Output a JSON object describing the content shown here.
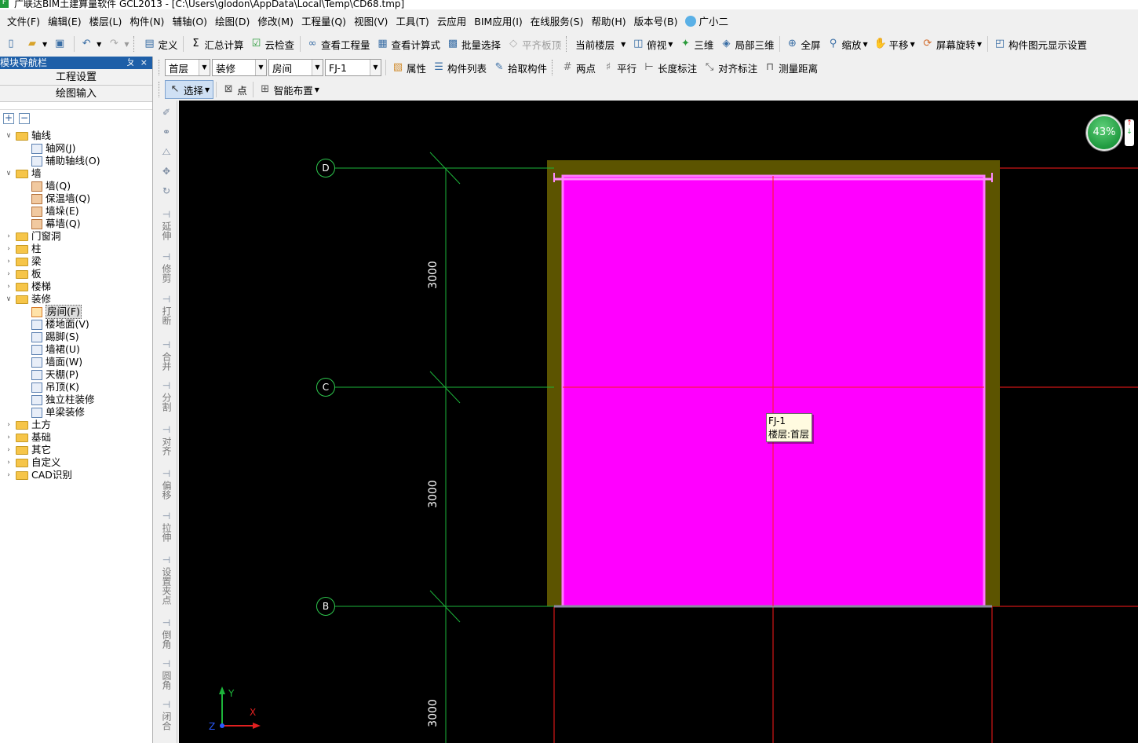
{
  "window": {
    "title": "广联达BIM土建算量软件 GCL2013 - [C:\\Users\\glodon\\AppData\\Local\\Temp\\CD68.tmp]"
  },
  "menu": [
    "文件(F)",
    "编辑(E)",
    "楼层(L)",
    "构件(N)",
    "辅轴(O)",
    "绘图(D)",
    "修改(M)",
    "工程量(Q)",
    "视图(V)",
    "工具(T)",
    "云应用",
    "BIM应用(I)",
    "在线服务(S)",
    "帮助(H)",
    "版本号(B)",
    "广小二"
  ],
  "toolbar1": {
    "define": "定义",
    "sum_calc": "汇总计算",
    "cloud_check": "云检查",
    "view_quantity": "查看工程量",
    "view_formula": "查看计算式",
    "batch_select": "批量选择",
    "align_top": "平齐板顶",
    "current_floor": "当前楼层",
    "top_view": "俯视",
    "three_d": "三维",
    "local_3d": "局部三维",
    "fullscreen": "全屏",
    "zoom": "缩放",
    "pan": "平移",
    "screen_rotate": "屏幕旋转",
    "display_settings": "构件图元显示设置"
  },
  "toolbar2": {
    "floor": "首层",
    "category": "装修",
    "type": "房间",
    "component": "FJ-1",
    "properties": "属性",
    "component_list": "构件列表",
    "pick_component": "拾取构件",
    "two_points": "两点",
    "parallel": "平行",
    "length_dim": "长度标注",
    "align_dim": "对齐标注",
    "measure_distance": "测量距离"
  },
  "toolbar3": {
    "select": "选择",
    "point": "点",
    "smart_layout": "智能布置"
  },
  "nav": {
    "title": "模块导航栏",
    "pin": "ㄆ",
    "close": "×",
    "tab_project": "工程设置",
    "tab_drawing": "绘图输入",
    "tree": [
      {
        "label": "轴线",
        "level": 0,
        "kind": "folder",
        "expanded": true
      },
      {
        "label": "轴网(J)",
        "level": 1,
        "kind": "leaf"
      },
      {
        "label": "辅助轴线(O)",
        "level": 1,
        "kind": "leaf"
      },
      {
        "label": "墙",
        "level": 0,
        "kind": "folder",
        "expanded": true
      },
      {
        "label": "墙(Q)",
        "level": 1,
        "kind": "brick"
      },
      {
        "label": "保温墙(Q)",
        "level": 1,
        "kind": "brick"
      },
      {
        "label": "墙垛(E)",
        "level": 1,
        "kind": "brick"
      },
      {
        "label": "幕墙(Q)",
        "level": 1,
        "kind": "brick"
      },
      {
        "label": "门窗洞",
        "level": 0,
        "kind": "folder",
        "expanded": false
      },
      {
        "label": "柱",
        "level": 0,
        "kind": "folder",
        "expanded": false
      },
      {
        "label": "梁",
        "level": 0,
        "kind": "folder",
        "expanded": false
      },
      {
        "label": "板",
        "level": 0,
        "kind": "folder",
        "expanded": false
      },
      {
        "label": "楼梯",
        "level": 0,
        "kind": "folder",
        "expanded": false
      },
      {
        "label": "装修",
        "level": 0,
        "kind": "folder",
        "expanded": true
      },
      {
        "label": "房间(F)",
        "level": 1,
        "kind": "room",
        "selected": true
      },
      {
        "label": "楼地面(V)",
        "level": 1,
        "kind": "leaf"
      },
      {
        "label": "踢脚(S)",
        "level": 1,
        "kind": "leaf"
      },
      {
        "label": "墙裙(U)",
        "level": 1,
        "kind": "leaf"
      },
      {
        "label": "墙面(W)",
        "level": 1,
        "kind": "leaf"
      },
      {
        "label": "天棚(P)",
        "level": 1,
        "kind": "leaf"
      },
      {
        "label": "吊顶(K)",
        "level": 1,
        "kind": "leaf"
      },
      {
        "label": "独立柱装修",
        "level": 1,
        "kind": "leaf"
      },
      {
        "label": "单梁装修",
        "level": 1,
        "kind": "leaf"
      },
      {
        "label": "土方",
        "level": 0,
        "kind": "folder",
        "expanded": false
      },
      {
        "label": "基础",
        "level": 0,
        "kind": "folder",
        "expanded": false
      },
      {
        "label": "其它",
        "level": 0,
        "kind": "folder",
        "expanded": false
      },
      {
        "label": "自定义",
        "level": 0,
        "kind": "folder",
        "expanded": false
      },
      {
        "label": "CAD识别",
        "level": 0,
        "kind": "folder",
        "expanded": false
      }
    ]
  },
  "side_tools": [
    "延伸",
    "修剪",
    "打断",
    "合并",
    "分割",
    "对齐",
    "偏移",
    "拉伸",
    "设置夹点",
    "倒角",
    "圆角",
    "闭合"
  ],
  "canvas": {
    "axes": [
      "D",
      "C",
      "B"
    ],
    "dimensions": [
      "3000",
      "3000",
      "3000"
    ],
    "tooltip_line1": "FJ-1",
    "tooltip_line2": "楼层:首层",
    "zoom_percent": "43%",
    "ucs_y": "Y",
    "ucs_x": "X",
    "ucs_z": "Z",
    "colors": {
      "room_fill": "#ff00ff",
      "wall": "#5c5400",
      "axis": "#1db33a",
      "grid_red": "#ff1a1a"
    }
  }
}
